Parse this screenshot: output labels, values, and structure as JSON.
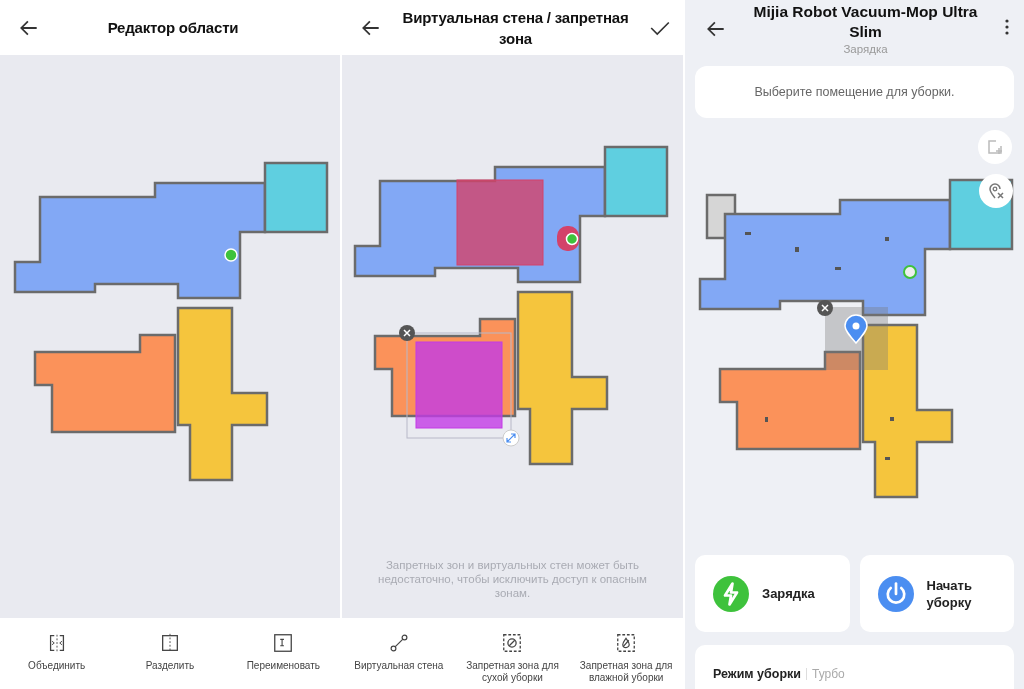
{
  "panels": [
    {
      "kind": "editor",
      "title": "Редактор области",
      "tools": [
        {
          "kind": "merge",
          "label": "Объединить"
        },
        {
          "kind": "split",
          "label": "Разделить"
        },
        {
          "kind": "rename",
          "label": "Переименовать"
        }
      ]
    },
    {
      "kind": "zones",
      "title": "Виртуальная стена / запретная зона",
      "notice": "Запретных зон и виртуальных стен может быть недостаточно, чтобы исключить доступ к опасным зонам.",
      "tools": [
        {
          "kind": "wall",
          "label": "Виртуальная стена"
        },
        {
          "kind": "dry",
          "label": "Запретная зона для сухой уборки"
        },
        {
          "kind": "wet",
          "label": "Запретная зона для влажной уборки"
        }
      ]
    },
    {
      "kind": "device",
      "title": "Mijia Robot Vacuum-Mop Ultra Slim",
      "subtitle": "Зарядка",
      "prompt": "Выберите помещение для уборки.",
      "actions": [
        {
          "kind": "charge",
          "label": "Зарядка",
          "color": "#3ec23c"
        },
        {
          "kind": "start",
          "label": "Начать уборку",
          "color": "#4b8ef1"
        }
      ],
      "mode": {
        "label": "Режим уборки",
        "value": "Турбо"
      }
    }
  ]
}
